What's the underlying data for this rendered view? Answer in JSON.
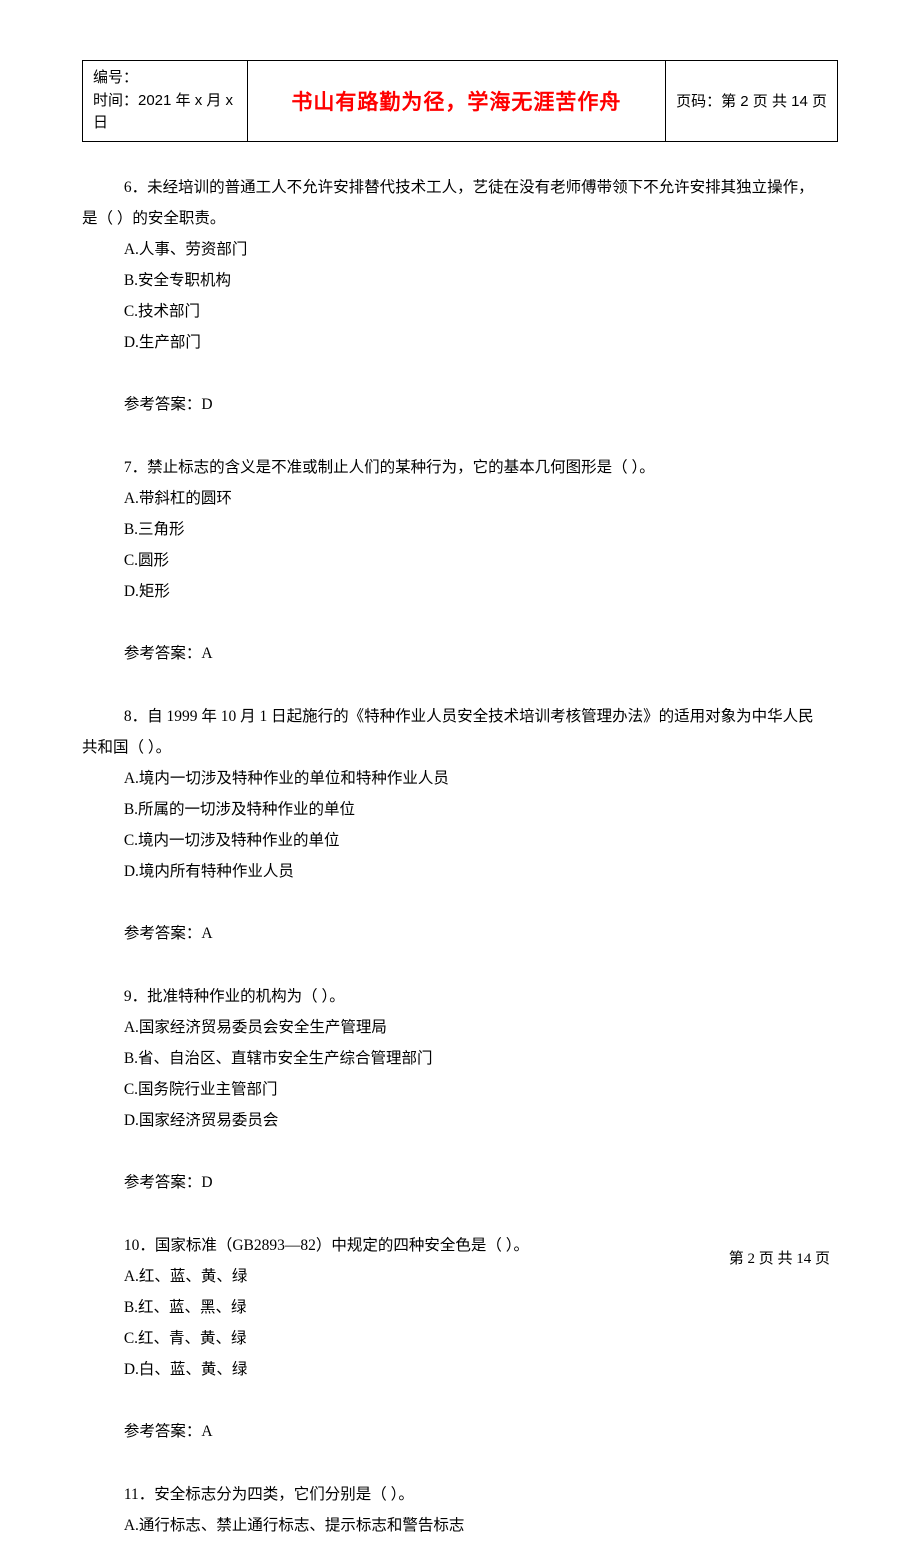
{
  "header": {
    "label_bianhao": "编号：",
    "label_time": "时间：2021 年 x 月 x 日",
    "center_text": "书山有路勤为径，学海无涯苦作舟",
    "page_label": "页码：第 2 页  共 14 页"
  },
  "questions": [
    {
      "number": "6．",
      "text_line1": "未经培训的普通工人不允许安排替代技术工人，艺徒在没有老师傅带领下不允许安排其独立操作，",
      "text_line2": "是（    ）的安全职责。",
      "options": {
        "a": "A.人事、劳资部门",
        "b": "B.安全专职机构",
        "c": "C.技术部门",
        "d": "D.生产部门"
      },
      "answer": "参考答案：D"
    },
    {
      "number": "7．",
      "text": "禁止标志的含义是不准或制止人们的某种行为，它的基本几何图形是（    ）。",
      "options": {
        "a": "A.带斜杠的圆环",
        "b": "B.三角形",
        "c": "C.圆形",
        "d": "D.矩形"
      },
      "answer": "参考答案：A"
    },
    {
      "number": "8．",
      "text_line1": "自 1999 年 10 月 1 日起施行的《特种作业人员安全技术培训考核管理办法》的适用对象为中华人民",
      "text_line2": "共和国（    ）。",
      "options": {
        "a": "A.境内一切涉及特种作业的单位和特种作业人员",
        "b": "B.所属的一切涉及特种作业的单位",
        "c": "C.境内一切涉及特种作业的单位",
        "d": "D.境内所有特种作业人员"
      },
      "answer": "参考答案：A"
    },
    {
      "number": "9．",
      "text": "批准特种作业的机构为（    ）。",
      "options": {
        "a": "A.国家经济贸易委员会安全生产管理局",
        "b": "B.省、自治区、直辖市安全生产综合管理部门",
        "c": "C.国务院行业主管部门",
        "d": "D.国家经济贸易委员会"
      },
      "answer": "参考答案：D"
    },
    {
      "number": "10．",
      "text": "国家标准（GB2893—82）中规定的四种安全色是（    ）。",
      "options": {
        "a": "A.红、蓝、黄、绿",
        "b": "B.红、蓝、黑、绿",
        "c": "C.红、青、黄、绿",
        "d": "D.白、蓝、黄、绿"
      },
      "answer": "参考答案：A"
    },
    {
      "number": "11．",
      "text": "安全标志分为四类，它们分别是（    ）。",
      "options": {
        "a": "A.通行标志、禁止通行标志、提示标志和警告标志"
      }
    }
  ],
  "footer": {
    "text": "第 2 页 共 14 页"
  }
}
